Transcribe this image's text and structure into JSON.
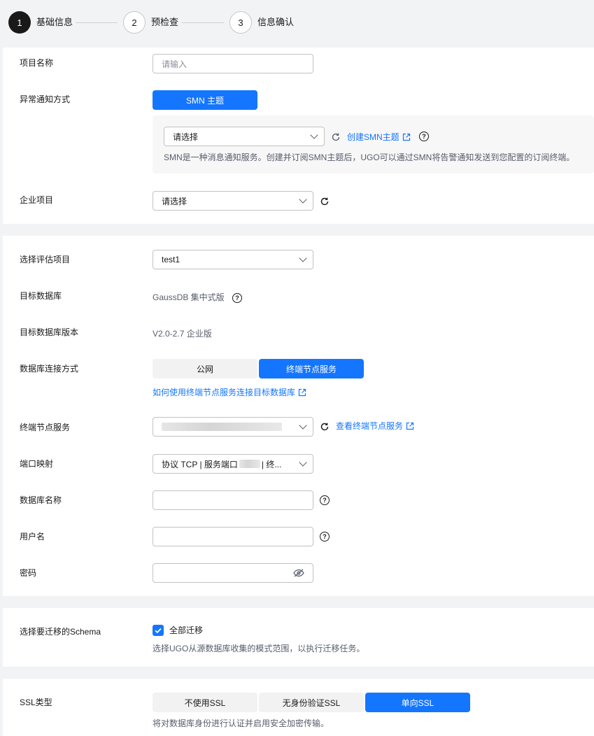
{
  "steps": [
    {
      "num": "1",
      "label": "基础信息"
    },
    {
      "num": "2",
      "label": "预检查"
    },
    {
      "num": "3",
      "label": "信息确认"
    }
  ],
  "project": {
    "name_label": "项目名称",
    "name_placeholder": "请输入",
    "notify_label": "异常通知方式",
    "notify_button": "SMN 主题",
    "smn_select": "请选择",
    "smn_create_link": "创建SMN主题",
    "smn_hint": "SMN是一种消息通知服务。创建并订阅SMN主题后，UGO可以通过SMN将告警通知发送到您配置的订阅终端。",
    "enterprise_label": "企业项目",
    "enterprise_select": "请选择"
  },
  "database": {
    "eval_label": "选择评估项目",
    "eval_value": "test1",
    "target_db_label": "目标数据库",
    "target_db_value": "GaussDB 集中式版",
    "target_ver_label": "目标数据库版本",
    "target_ver_value": "V2.0-2.7 企业版",
    "conn_label": "数据库连接方式",
    "conn_options": [
      "公网",
      "终端节点服务"
    ],
    "conn_help_link": "如何使用终端节点服务连接目标数据库",
    "endpoint_label": "终端节点服务",
    "endpoint_view_link": "查看终端节点服务",
    "port_label": "端口映射",
    "port_value_prefix": "协议 TCP | 服务端口",
    "port_value_suffix": "| 终...",
    "dbname_label": "数据库名称",
    "user_label": "用户名",
    "password_label": "密码"
  },
  "schema": {
    "label": "选择要迁移的Schema",
    "checkbox_label": "全部迁移",
    "hint": "选择UGO从源数据库收集的模式范围，以执行迁移任务。"
  },
  "ssl": {
    "label": "SSL类型",
    "options": [
      "不使用SSL",
      "无身份验证SSL",
      "单向SSL"
    ],
    "hint": "将对数据库身份进行认证并启用安全加密传输。"
  },
  "colors": {
    "accent": "#1476ff",
    "text": "#191919",
    "muted": "#8a8e99"
  }
}
